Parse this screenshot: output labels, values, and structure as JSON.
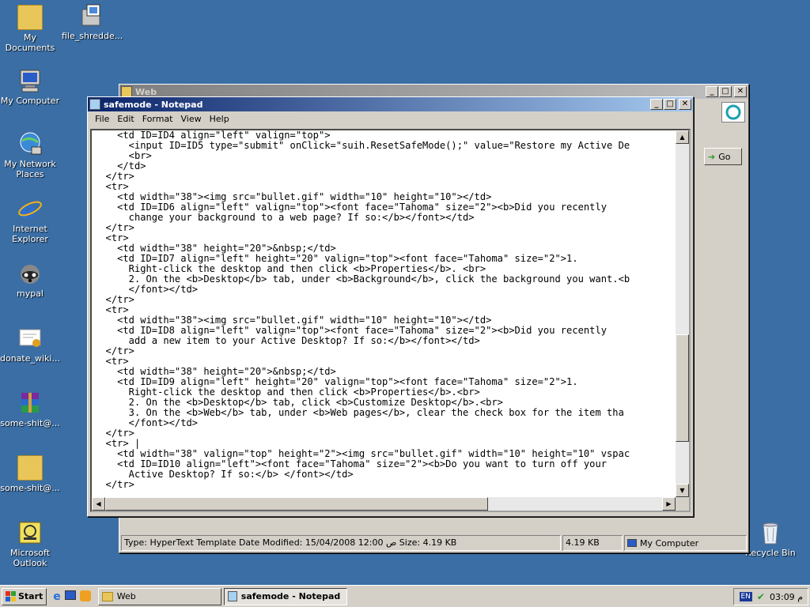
{
  "desktop": {
    "icons": [
      {
        "label": "My Documents"
      },
      {
        "label": "file_shredde..."
      },
      {
        "label": "My Computer"
      },
      {
        "label": "My Network Places"
      },
      {
        "label": "Internet Explorer"
      },
      {
        "label": "mypal"
      },
      {
        "label": "donate_wiki..."
      },
      {
        "label": "some-shit@..."
      },
      {
        "label": "some-shit@..."
      },
      {
        "label": "Microsoft Outlook"
      },
      {
        "label": "Recycle Bin"
      }
    ]
  },
  "explorer": {
    "title": "Web",
    "go_label": "Go",
    "status": {
      "info": "Type: HyperText Template Date Modified: 15/04/2008 12:00 ص Size: 4.19 KB",
      "size": "4.19 KB",
      "zone": "My Computer"
    }
  },
  "notepad": {
    "title": "safemode - Notepad",
    "menu": [
      "File",
      "Edit",
      "Format",
      "View",
      "Help"
    ],
    "lines": [
      "    <td ID=ID4 align=\"left\" valign=\"top\">",
      "      <input ID=ID5 type=\"submit\" onClick=\"suih.ResetSafeMode();\" value=\"Restore my Active De",
      "      <br>",
      "    </td>",
      "  </tr>",
      "  <tr>",
      "    <td width=\"38\"><img src=\"bullet.gif\" width=\"10\" height=\"10\"></td>",
      "    <td ID=ID6 align=\"left\" valign=\"top\"><font face=\"Tahoma\" size=\"2\"><b>Did you recently",
      "      change your background to a web page? If so:</b></font></td>",
      "  </tr>",
      "  <tr>",
      "    <td width=\"38\" height=\"20\">&nbsp;</td>",
      "    <td ID=ID7 align=\"left\" height=\"20\" valign=\"top\"><font face=\"Tahoma\" size=\"2\">1.",
      "      Right-click the desktop and then click <b>Properties</b>. <br>",
      "      2. On the <b>Desktop</b> tab, under <b>Background</b>, click the background you want.<b",
      "      </font></td>",
      "  </tr>",
      "  <tr>",
      "    <td width=\"38\"><img src=\"bullet.gif\" width=\"10\" height=\"10\"></td>",
      "    <td ID=ID8 align=\"left\" valign=\"top\"><font face=\"Tahoma\" size=\"2\"><b>Did you recently",
      "      add a new item to your Active Desktop? If so:</b></font></td>",
      "  </tr>",
      "  <tr>",
      "    <td width=\"38\" height=\"20\">&nbsp;</td>",
      "    <td ID=ID9 align=\"left\" height=\"20\" valign=\"top\"><font face=\"Tahoma\" size=\"2\">1.",
      "      Right-click the desktop and then click <b>Properties</b>.<br>",
      "      2. On the <b>Desktop</b> tab, click <b>Customize Desktop</b>.<br>",
      "      3. On the <b>Web</b> tab, under <b>Web pages</b>, clear the check box for the item tha",
      "      </font></td>",
      "  </tr>",
      "  <tr> |",
      "    <td width=\"38\" valign=\"top\" height=\"2\"><img src=\"bullet.gif\" width=\"10\" height=\"10\" vspac",
      "    <td ID=ID10 align=\"left\"><font face=\"Tahoma\" size=\"2\"><b>Do you want to turn off your",
      "      Active Desktop? If so:</b> </font></td>",
      "  </tr>"
    ]
  },
  "taskbar": {
    "start_label": "Start",
    "tasks": [
      {
        "label": "Web"
      },
      {
        "label": "safemode - Notepad"
      }
    ],
    "lang": "EN",
    "clock": "03:09 م"
  },
  "colors": {
    "desktop": "#3a6ea5",
    "active_title": "#0a246a",
    "chrome": "#d4d0c8"
  }
}
